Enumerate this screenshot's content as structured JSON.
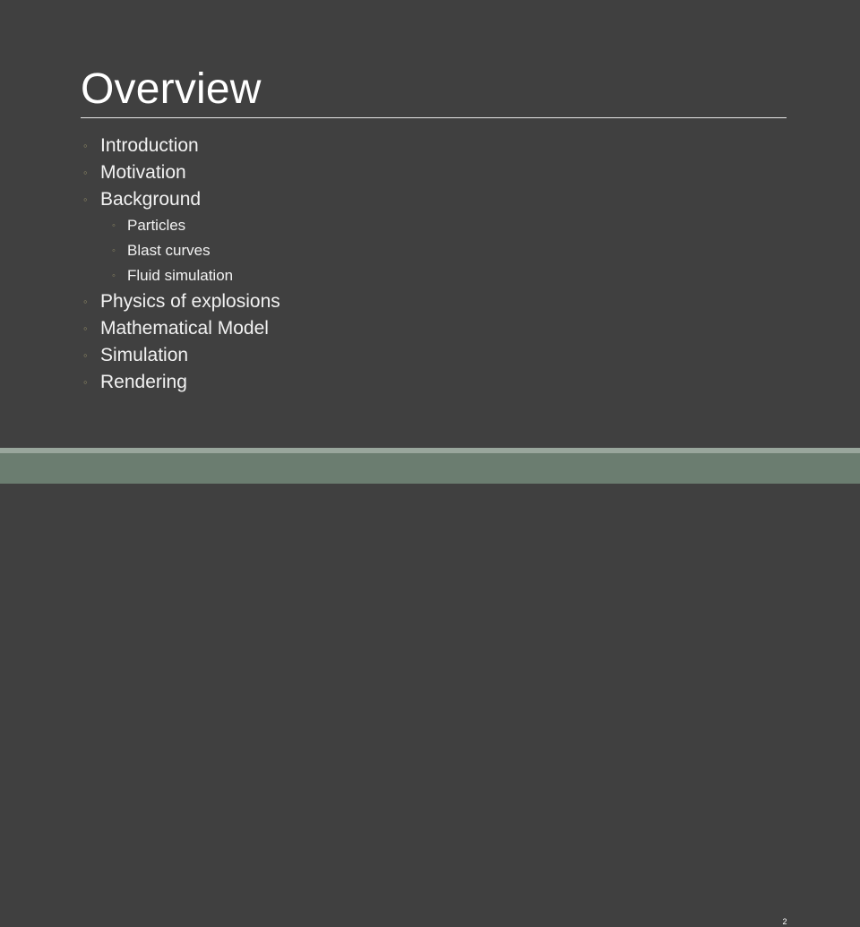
{
  "slide": {
    "title": "Overview",
    "background_color": "#404040",
    "title_color": "#ffffff",
    "body_text_color": "#f2f2f2",
    "bullet_color": "#8c8663",
    "rule_color": "#e8e8e8",
    "footer_accent_color": "#99a69c",
    "footer_band_color": "#6b7d70"
  },
  "bullet_glyph": "◦",
  "outline": [
    {
      "level": 1,
      "label": "Introduction"
    },
    {
      "level": 1,
      "label": "Motivation"
    },
    {
      "level": 1,
      "label": "Background"
    },
    {
      "level": 2,
      "label": "Particles"
    },
    {
      "level": 2,
      "label": "Blast curves"
    },
    {
      "level": 2,
      "label": "Fluid simulation"
    },
    {
      "level": 1,
      "label": "Physics of explosions"
    },
    {
      "level": 1,
      "label": "Mathematical Model"
    },
    {
      "level": 1,
      "label": "Simulation"
    },
    {
      "level": 1,
      "label": "Rendering"
    }
  ],
  "footer": {
    "slide_number": "2"
  }
}
